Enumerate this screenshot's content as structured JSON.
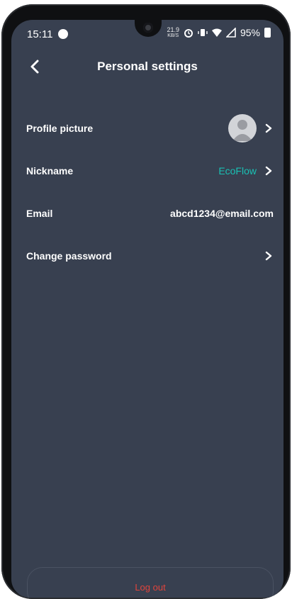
{
  "status_bar": {
    "time": "15:11",
    "net_speed_value": "21.9",
    "net_speed_unit": "KB/S",
    "battery": "95%"
  },
  "header": {
    "title": "Personal settings"
  },
  "settings": {
    "profile_picture_label": "Profile picture",
    "nickname_label": "Nickname",
    "nickname_value": "EcoFlow",
    "email_label": "Email",
    "email_value": "abcd1234@email.com",
    "change_password_label": "Change password"
  },
  "footer": {
    "logout_label": "Log out"
  },
  "colors": {
    "background": "#384050",
    "accent": "#19c1b4",
    "danger": "#e0443c"
  },
  "icons": [
    "back-chevron-icon",
    "chevron-right-icon",
    "avatar-placeholder-icon",
    "alarm-icon",
    "vibrate-icon",
    "wifi-icon",
    "signal-icon",
    "battery-icon"
  ]
}
